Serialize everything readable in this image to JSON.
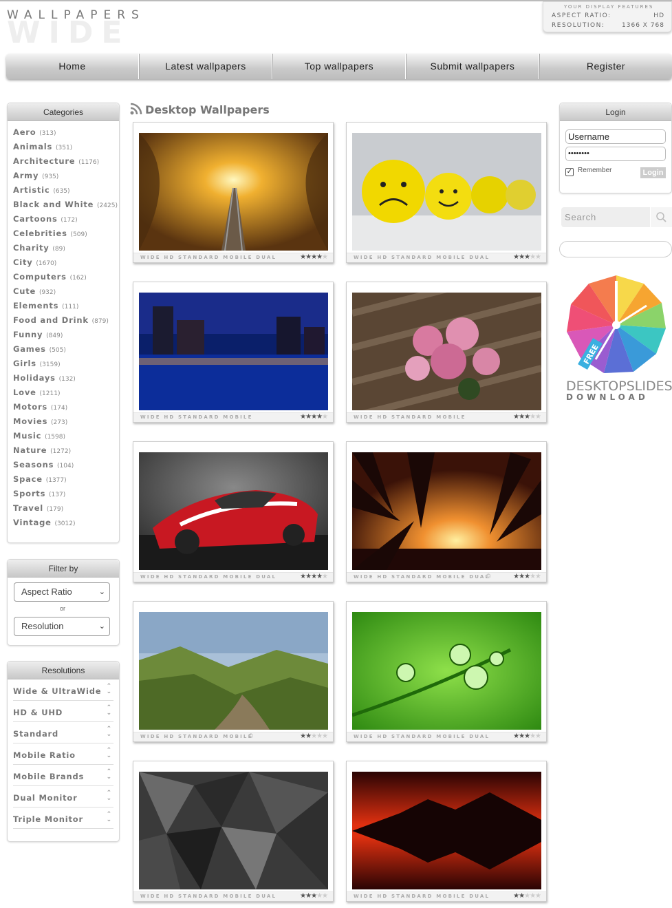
{
  "logo": {
    "line1": "WALLPAPERS",
    "line2": "WIDE"
  },
  "display_features": {
    "title": "YOUR DISPLAY FEATURES",
    "aspect_label": "ASPECT RATIO:",
    "aspect_value": "HD",
    "resolution_label": "RESOLUTION:",
    "resolution_value": "1366 X 768"
  },
  "nav": [
    "Home",
    "Latest wallpapers",
    "Top wallpapers",
    "Submit wallpapers",
    "Register"
  ],
  "categories": {
    "title": "Categories",
    "items": [
      {
        "name": "Aero",
        "count": "(313)"
      },
      {
        "name": "Animals",
        "count": "(351)"
      },
      {
        "name": "Architecture",
        "count": "(1176)"
      },
      {
        "name": "Army",
        "count": "(935)"
      },
      {
        "name": "Artistic",
        "count": "(635)"
      },
      {
        "name": "Black and White",
        "count": "(2425)"
      },
      {
        "name": "Cartoons",
        "count": "(172)"
      },
      {
        "name": "Celebrities",
        "count": "(509)"
      },
      {
        "name": "Charity",
        "count": "(89)"
      },
      {
        "name": "City",
        "count": "(1670)"
      },
      {
        "name": "Computers",
        "count": "(162)"
      },
      {
        "name": "Cute",
        "count": "(932)"
      },
      {
        "name": "Elements",
        "count": "(111)"
      },
      {
        "name": "Food and Drink",
        "count": "(879)"
      },
      {
        "name": "Funny",
        "count": "(849)"
      },
      {
        "name": "Games",
        "count": "(505)"
      },
      {
        "name": "Girls",
        "count": "(3159)"
      },
      {
        "name": "Holidays",
        "count": "(132)"
      },
      {
        "name": "Love",
        "count": "(1211)"
      },
      {
        "name": "Motors",
        "count": "(174)"
      },
      {
        "name": "Movies",
        "count": "(273)"
      },
      {
        "name": "Music",
        "count": "(1598)"
      },
      {
        "name": "Nature",
        "count": "(1272)"
      },
      {
        "name": "Seasons",
        "count": "(104)"
      },
      {
        "name": "Space",
        "count": "(1377)"
      },
      {
        "name": "Sports",
        "count": "(137)"
      },
      {
        "name": "Travel",
        "count": "(179)"
      },
      {
        "name": "Vintage",
        "count": "(3012)"
      }
    ]
  },
  "filter": {
    "title": "Filter by",
    "aspect_select": "Aspect Ratio",
    "or_label": "or",
    "resolution_select": "Resolution"
  },
  "resolutions": {
    "title": "Resolutions",
    "items": [
      "Wide & UltraWide",
      "HD & UHD",
      "Standard",
      "Mobile Ratio",
      "Mobile Brands",
      "Dual Monitor",
      "Triple Monitor"
    ]
  },
  "main": {
    "title": "Desktop Wallpapers",
    "wallpapers": [
      {
        "subject": "autumn-railway",
        "formats": "WIDE  HD  STANDARD  MOBILE  DUAL",
        "rating": 3.5,
        "copyright": false
      },
      {
        "subject": "yellow-smiley-balls",
        "formats": "WIDE  HD  STANDARD  MOBILE  DUAL",
        "rating": 3,
        "copyright": false
      },
      {
        "subject": "night-city-harbor",
        "formats": "WIDE  HD  STANDARD  MOBILE",
        "rating": 4,
        "copyright": false
      },
      {
        "subject": "pink-peonies",
        "formats": "WIDE  HD  STANDARD  MOBILE",
        "rating": 3,
        "copyright": false
      },
      {
        "subject": "red-sports-car",
        "formats": "WIDE  HD  STANDARD  MOBILE  DUAL",
        "rating": 4,
        "copyright": false
      },
      {
        "subject": "palm-sunset",
        "formats": "WIDE  HD  STANDARD  MOBILE  DUAL",
        "rating": 2.5,
        "copyright": true
      },
      {
        "subject": "mountain-valley",
        "formats": "WIDE  HD  STANDARD  MOBILE",
        "rating": 2,
        "copyright": true
      },
      {
        "subject": "water-drops-green",
        "formats": "WIDE  HD  STANDARD  MOBILE  DUAL",
        "rating": 2.5,
        "copyright": false
      },
      {
        "subject": "dark-polygons",
        "formats": "WIDE  HD  STANDARD  MOBILE  DUAL",
        "rating": 3,
        "copyright": false
      },
      {
        "subject": "red-lake-reflection",
        "formats": "WIDE  HD  STANDARD  MOBILE  DUAL",
        "rating": 2,
        "copyright": false
      }
    ]
  },
  "login": {
    "title": "Login",
    "username_value": "Username",
    "password_value": "••••••••",
    "remember_label": "Remember",
    "button_label": "Login"
  },
  "search": {
    "placeholder": "Search"
  },
  "ad": {
    "line1": "DESKTOPSLIDES",
    "line2": "DOWNLOAD",
    "tag": "FREE"
  },
  "colors": {
    "nav_gradient_top": "#f4f4f4",
    "nav_gradient_bottom": "#bdbdbd",
    "text_gray": "#777777"
  }
}
